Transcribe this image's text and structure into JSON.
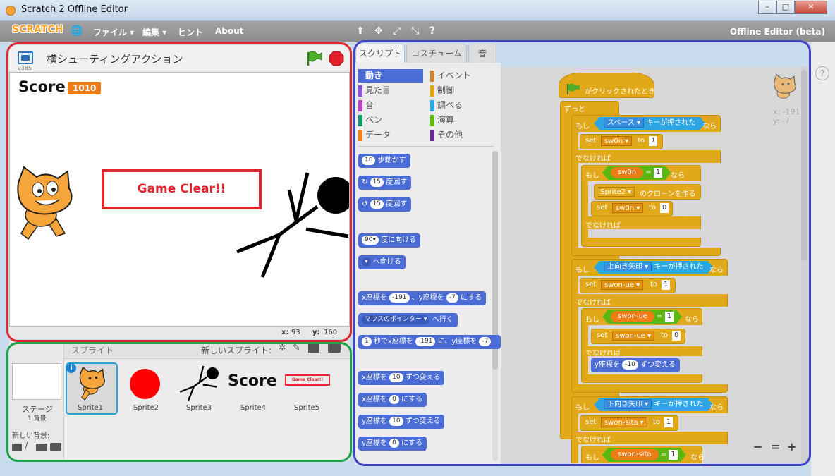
{
  "window": {
    "title": "Scratch 2 Offline Editor",
    "min": "–",
    "max": "□",
    "close": "✕"
  },
  "menu": {
    "logo": "SCRATCH",
    "globe": "🌐",
    "file": "ファイル ▾",
    "edit": "編集 ▾",
    "hint": "ヒント",
    "about": "About",
    "tools": [
      "⬆",
      "✥",
      "⤢",
      "⤡",
      "?"
    ],
    "offline": "Offline Editor (beta)"
  },
  "stage": {
    "project_title": "横シューティングアクション",
    "version": "v385",
    "score_label": "Score",
    "score_value": "1010",
    "game_clear": "Game Clear!!",
    "x_label": "x:",
    "x_value": "93",
    "y_label": "y:",
    "y_value": "160"
  },
  "sprites": {
    "header": "スプライト",
    "new_sprite": "新しいスプライト:",
    "stage_label": "ステージ",
    "stage_sub": "1 背景",
    "new_backdrop": "新しい背景:",
    "items": [
      "Sprite1",
      "Sprite2",
      "Sprite3",
      "Sprite4",
      "Sprite5"
    ],
    "sprite4_text": "Score",
    "sprite5_text": "Game Clear!!"
  },
  "tabs": [
    "スクリプト",
    "コスチューム",
    "音"
  ],
  "categories": [
    {
      "label": "動き",
      "color": "#4a6cd4"
    },
    {
      "label": "イベント",
      "color": "#c88330"
    },
    {
      "label": "見た目",
      "color": "#8a55d7"
    },
    {
      "label": "制御",
      "color": "#e1a91a"
    },
    {
      "label": "音",
      "color": "#bb42c3"
    },
    {
      "label": "調べる",
      "color": "#2ca5e2"
    },
    {
      "label": "ペン",
      "color": "#0e9a6c"
    },
    {
      "label": "演算",
      "color": "#5cb712"
    },
    {
      "label": "データ",
      "color": "#ee7d16"
    },
    {
      "label": "その他",
      "color": "#632d99"
    }
  ],
  "palette_blocks": {
    "move": {
      "n": "10",
      "t": "歩動かす"
    },
    "turn_r": {
      "n": "15",
      "t": "度回す"
    },
    "turn_l": {
      "n": "15",
      "t": "度回す"
    },
    "point_dir": {
      "n": "90▾",
      "t": "度に向ける"
    },
    "point_to": {
      "n": "▾",
      "t": "へ向ける"
    },
    "goto_xy": {
      "a": "x座標を",
      "x": "-191",
      "b": "、y座標を",
      "y": "-7",
      "c": "にする"
    },
    "goto_ptr": {
      "a": "マウスのポインター ▾",
      "b": "へ行く"
    },
    "glide": {
      "n": "1",
      "a": "秒でx座標を",
      "x": "-191",
      "b": "に、y座標を",
      "y": "-7"
    },
    "change_x": {
      "a": "x座標を",
      "n": "10",
      "b": "ずつ変える"
    },
    "set_x": {
      "a": "x座標を",
      "n": "0",
      "b": "にする"
    },
    "change_y": {
      "a": "y座標を",
      "n": "10",
      "b": "ずつ変える"
    },
    "set_y": {
      "a": "y座標を",
      "n": "0",
      "b": "にする"
    }
  },
  "script": {
    "hat": "がクリックされたとき",
    "forever": "ずっと",
    "if": "もし",
    "then": "なら",
    "else": "でなければ",
    "set": "set",
    "to": "to",
    "space_key": "スペース ▾",
    "key_pressed": "キーが押された",
    "var_sw0n": "sw0n ▾",
    "var_sw0n_plain": "sw0n",
    "one": "1",
    "zero": "0",
    "eq": "=",
    "clone_target": "Sprite2 ▾",
    "clone_text": "のクローンを作る",
    "up_key": "上向き矢印 ▾",
    "var_swon_ue": "swon-ue ▾",
    "var_swon_ue_plain": "swon-ue",
    "change_y_a": "y座標を",
    "change_y_n": "-10",
    "change_y_b": "ずつ変える",
    "down_key": "下向き矢印 ▾",
    "var_swon_sita": "swon-sita ▾",
    "var_swon_sita_plain": "swon-sita"
  },
  "sprite_info": {
    "x": "x: -191",
    "y": "y: -7"
  },
  "zoom": {
    "out": "−",
    "reset": "=",
    "in": "+"
  },
  "help": "?"
}
